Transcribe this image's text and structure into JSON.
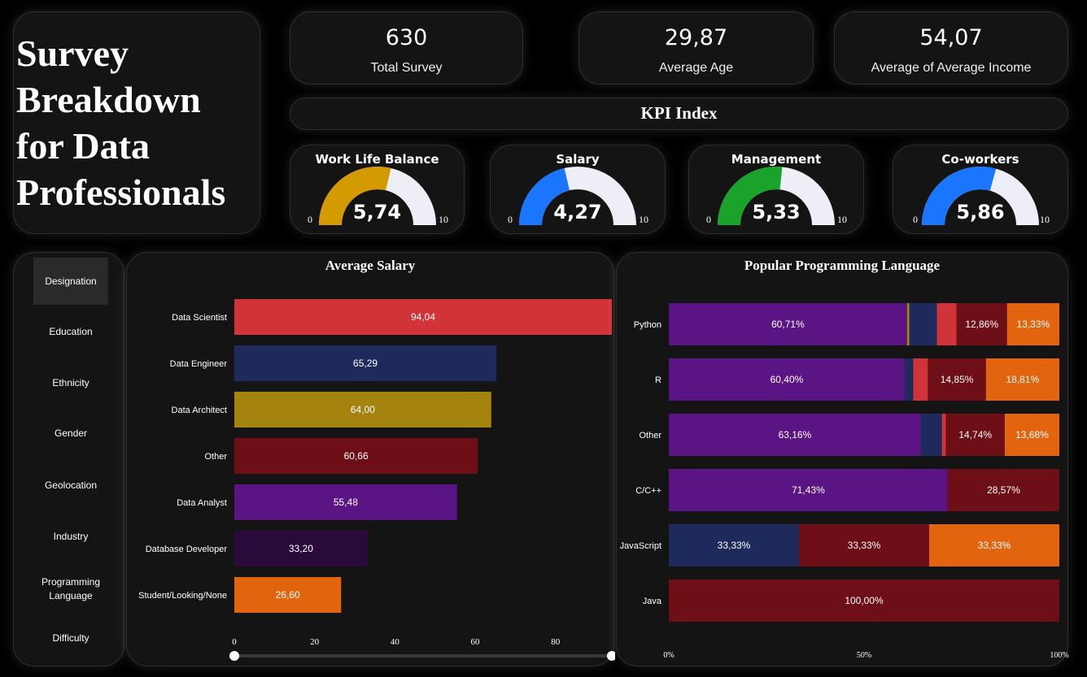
{
  "title": "Survey\nBreakdown\nfor Data\nProfessionals",
  "kpis": [
    {
      "value": "630",
      "label": "Total Survey"
    },
    {
      "value": "29,87",
      "label": "Average Age"
    },
    {
      "value": "54,07",
      "label": "Average of Average Income"
    }
  ],
  "kpi_index_title": "KPI Index",
  "gauges": [
    {
      "title": "Work Life Balance",
      "value_label": "5,74",
      "value": 5.74,
      "min": "0",
      "max": "10",
      "color": "#d39b00"
    },
    {
      "title": "Salary",
      "value_label": "4,27",
      "value": 4.27,
      "min": "0",
      "max": "10",
      "color": "#1a75ff"
    },
    {
      "title": "Management",
      "value_label": "5,33",
      "value": 5.33,
      "min": "0",
      "max": "10",
      "color": "#1aa32a"
    },
    {
      "title": "Co-workers",
      "value_label": "5,86",
      "value": 5.86,
      "min": "0",
      "max": "10",
      "color": "#1a75ff"
    }
  ],
  "gauge_track_color": "#eeeef6",
  "nav": {
    "active_index": 0,
    "items": [
      "Designation",
      "Education",
      "Ethnicity",
      "Gender",
      "Geolocation",
      "Industry",
      "Programming Language",
      "Difficulty"
    ]
  },
  "chart_data": [
    {
      "type": "bar",
      "orientation": "horizontal",
      "title": "Average Salary",
      "categories": [
        "Data Scientist",
        "Data Engineer",
        "Data Architect",
        "Other",
        "Data Analyst",
        "Database Developer",
        "Student/Looking/None"
      ],
      "values": [
        94.04,
        65.29,
        64.0,
        60.66,
        55.48,
        33.2,
        26.6
      ],
      "value_labels": [
        "94,04",
        "65,29",
        "64,00",
        "60,66",
        "55,48",
        "33,20",
        "26,60"
      ],
      "colors": [
        "#d13438",
        "#1f2a5c",
        "#a5830f",
        "#6e0f17",
        "#5b1484",
        "#2a0a3a",
        "#e3640f"
      ],
      "xticks": [
        "0",
        "20",
        "40",
        "60",
        "80"
      ],
      "xtick_values": [
        0,
        20,
        40,
        60,
        80
      ],
      "xlim": [
        0,
        94.04
      ]
    },
    {
      "type": "bar",
      "orientation": "horizontal",
      "stacked": "100%",
      "title": "Popular Programming Language",
      "categories": [
        "Python",
        "R",
        "Other",
        "C/C++",
        "JavaScript",
        "Java"
      ],
      "segment_colors": [
        "#5b1484",
        "#a5830f",
        "#1f2a5c",
        "#d13438",
        "#6e0f17",
        "#e3640f"
      ],
      "rows": [
        {
          "values": [
            60.71,
            0.6,
            7.0,
            5.0,
            12.86,
            13.33
          ],
          "labels": [
            "60,71%",
            "",
            "",
            "",
            "12,86%",
            "13,33%"
          ]
        },
        {
          "values": [
            60.4,
            0,
            2.2,
            3.74,
            14.85,
            18.81
          ],
          "labels": [
            "60,40%",
            "",
            "",
            "",
            "14,85%",
            "18,81%"
          ]
        },
        {
          "values": [
            63.16,
            0,
            5.26,
            1.0,
            14.74,
            13.68
          ],
          "labels": [
            "63,16%",
            "",
            "",
            "",
            "14,74%",
            "13,68%"
          ]
        },
        {
          "values": [
            71.43,
            0,
            0,
            0,
            28.57,
            0
          ],
          "labels": [
            "71,43%",
            "",
            "",
            "",
            "28,57%",
            ""
          ]
        },
        {
          "values": [
            0,
            0,
            33.33,
            0,
            33.33,
            33.33
          ],
          "labels": [
            "",
            "",
            "33,33%",
            "",
            "33,33%",
            "33,33%"
          ]
        },
        {
          "values": [
            0,
            0,
            0,
            0,
            100,
            0
          ],
          "labels": [
            "",
            "",
            "",
            "",
            "100,00%",
            ""
          ]
        }
      ],
      "xticks": [
        "0%",
        "50%",
        "100%"
      ],
      "xtick_values": [
        0,
        50,
        100
      ],
      "xlim": [
        0,
        100
      ]
    }
  ]
}
